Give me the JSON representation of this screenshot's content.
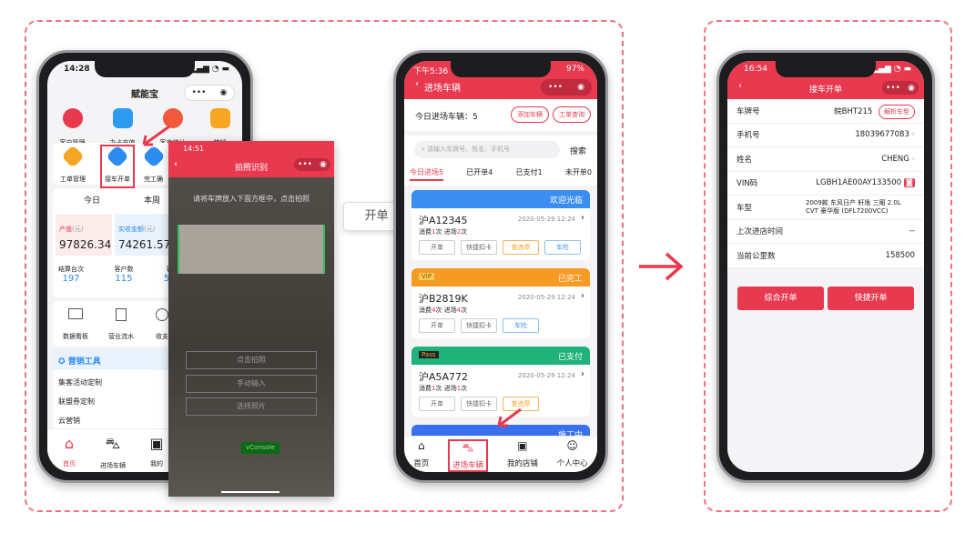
{
  "phone1": {
    "time": "14:28",
    "title": "赋能宝",
    "top_icons": [
      {
        "label": "客户管理",
        "icon": "customer-icon",
        "color": "#e8394f"
      },
      {
        "label": "办卡充值",
        "icon": "card-icon",
        "color": "#2d9bf0"
      },
      {
        "label": "客户统计",
        "icon": "pie-icon",
        "color": "#f05a3a"
      },
      {
        "label": "核销",
        "icon": "ticket-icon",
        "color": "#f5a623"
      }
    ],
    "flow": [
      {
        "label": "工单管理",
        "color": "#f5a623"
      },
      {
        "label": "接车开单",
        "color": "#2d8cf0"
      },
      {
        "label": "完工确",
        "color": "#2d8cf0"
      }
    ],
    "tabs": [
      "今日",
      "本周"
    ],
    "stat1": {
      "label": "产值",
      "unit": "(元)",
      "value": "97826.34"
    },
    "stat2": {
      "label": "实收金额",
      "unit": "(元)",
      "value": "74261.57"
    },
    "counts": [
      {
        "label": "结算台次",
        "value": "197"
      },
      {
        "label": "客户数",
        "value": "115"
      },
      {
        "label": "客单",
        "value": "539"
      }
    ],
    "tools": [
      "数据看板",
      "营业流水",
      "收支"
    ],
    "marketing_title": "营销工具",
    "marketing_items": [
      "集客活动定制",
      "联盟券定制",
      "云营销"
    ],
    "nav": [
      "首页",
      "进场车辆",
      "我的"
    ]
  },
  "camera": {
    "time": "14:51",
    "title": "拍照识别",
    "hint": "请将车牌放入下面方框中，点击拍照",
    "buttons": [
      "点击拍照",
      "手动输入",
      "选择照片"
    ],
    "vconsole": "vConsole"
  },
  "callout": "开单",
  "phone2": {
    "time": "下午5:36",
    "battery": "97%",
    "title": "进场车辆",
    "count_label": "今日进场车辆：5",
    "add_btn": "添加车辆",
    "query_btn": "工单查询",
    "search_placeholder": "请输入车牌号、姓名、手机号",
    "search_btn": "搜索",
    "tabs": [
      "今日进场5",
      "已开单4",
      "已支付1",
      "未开单0"
    ],
    "cards": [
      {
        "status": "欢迎光临",
        "color": "#3a8ef0",
        "badge": "",
        "plate": "沪A12345",
        "time": "2020-05-29  12:24",
        "consume": "1",
        "visits": "2",
        "actions": [
          "开单",
          "快捷扣卡",
          "查违章",
          "车险"
        ]
      },
      {
        "status": "已完工",
        "color": "#f59a23",
        "badge": "VIP",
        "plate": "沪B2819K",
        "time": "2020-05-29  12:24",
        "consume": "4",
        "visits": "4",
        "actions": [
          "开单",
          "快捷扣卡",
          "车险"
        ]
      },
      {
        "status": "已支付",
        "color": "#1fb27a",
        "badge": "Pass",
        "plate": "沪A5A772",
        "time": "2020-05-29  12:24",
        "consume": "1",
        "visits": "1",
        "actions": [
          "开单",
          "快捷扣卡",
          "查违章"
        ]
      },
      {
        "status": "施工中",
        "color": "#3a6ff0"
      }
    ],
    "consume_label": "消费",
    "visits_label": "进场",
    "times_unit": "次",
    "nav": [
      "首页",
      "进场车辆",
      "我的店铺",
      "个人中心"
    ]
  },
  "phone3": {
    "time": "16:54",
    "title": "接车开单",
    "rows": [
      {
        "label": "车牌号",
        "value": "皖BHT215"
      },
      {
        "label": "手机号",
        "value": "18039677083"
      },
      {
        "label": "姓名",
        "value": "CHENG"
      },
      {
        "label": "VIN码",
        "value": "LGBH1AE00AY133500"
      },
      {
        "label": "车型",
        "value": "2009款 东风日产 轩逸 三厢 2.0L CVT 豪华版 (DFL7200VCC)"
      },
      {
        "label": "上次进店时间",
        "value": "--"
      },
      {
        "label": "当前公里数",
        "value": "158500"
      }
    ],
    "parse_btn": "解析车型",
    "btn_full": "综合开单",
    "btn_quick": "快捷开单"
  },
  "colors": {
    "accent": "#e8394f",
    "dashed": "#f07080"
  }
}
